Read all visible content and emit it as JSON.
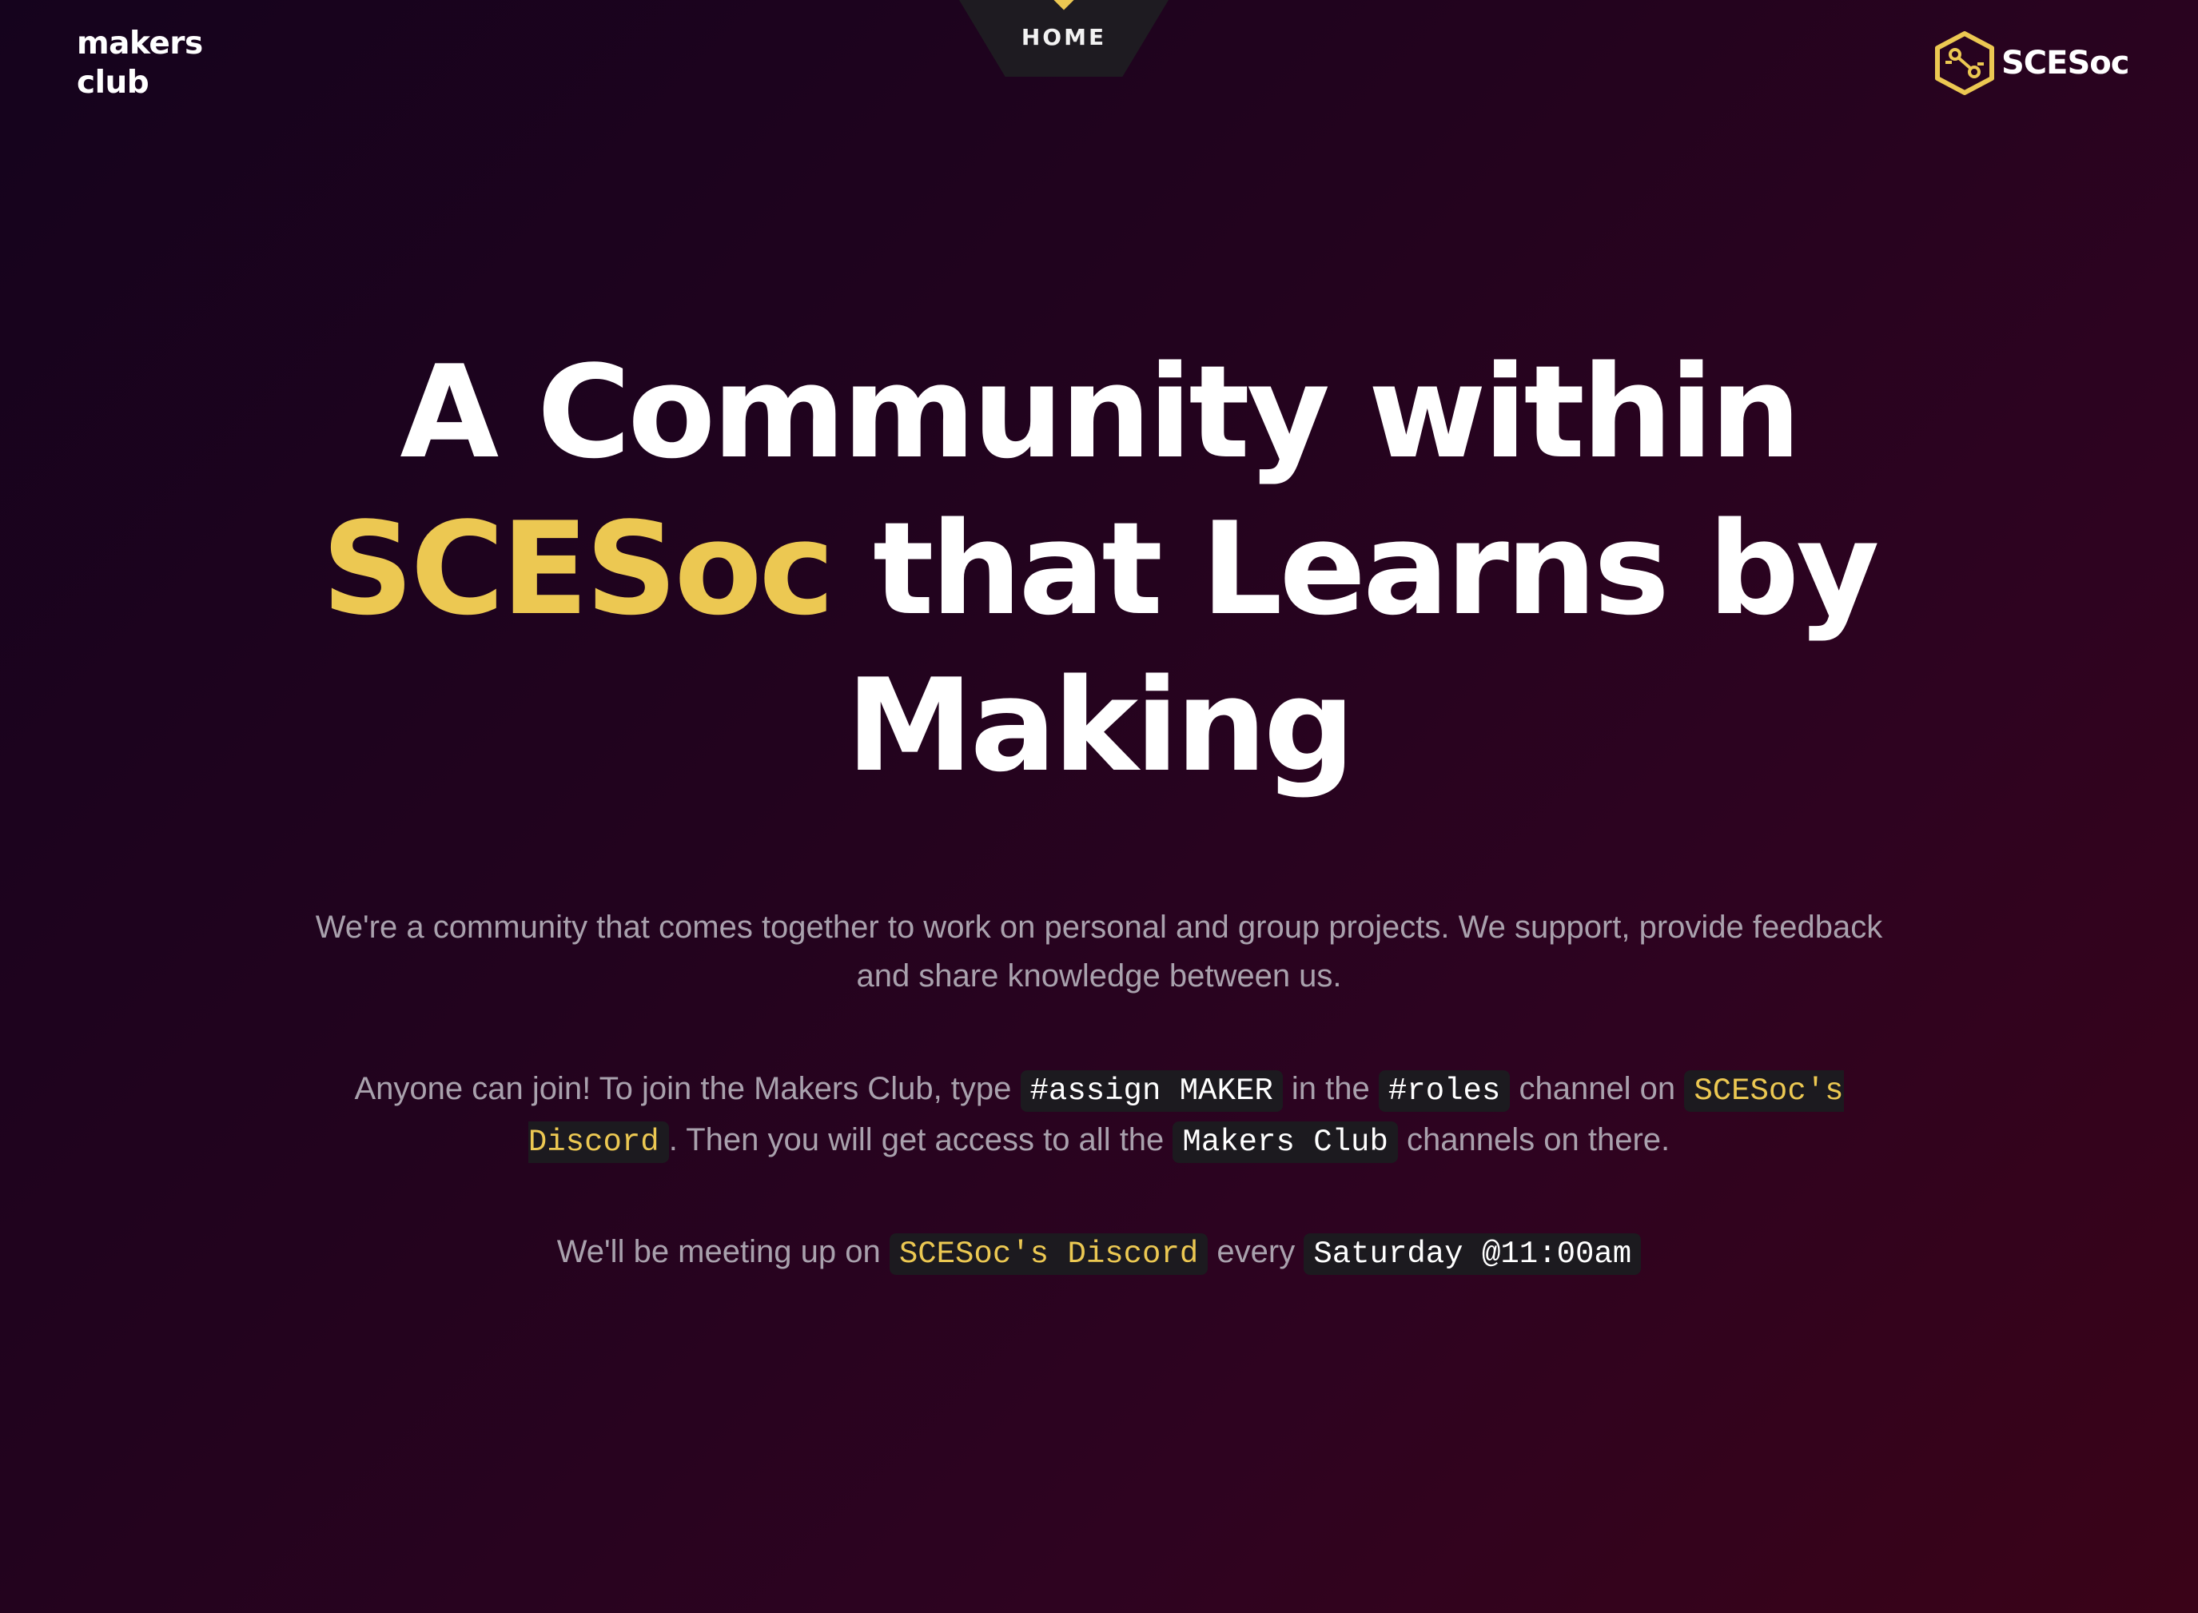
{
  "header": {
    "brand_line1": "makers",
    "brand_line2": "club",
    "nav_tab_label": "HOME",
    "org_logo_text": "SCESoc"
  },
  "hero": {
    "heading_part1": "A Community within",
    "heading_accent": "SCESoc",
    "heading_part2": "that Learns by Making"
  },
  "intro": {
    "text": "We're a community that comes together to work on personal and group projects. We support, provide feedback and share knowledge between us."
  },
  "join": {
    "text1": "Anyone can join! To join the Makers Club, type",
    "code_assign": "#assign MAKER",
    "text2": "in the",
    "code_roles": "#roles",
    "text3": "channel on",
    "code_discord": "SCESoc's Discord",
    "text4": ". Then you will get access to all the",
    "code_makers": "Makers Club",
    "text5": "channels on there."
  },
  "meetup": {
    "text1": "We'll be meeting up on",
    "code_discord": "SCESoc's Discord",
    "text2": "every",
    "code_time": "Saturday @11:00am"
  },
  "colors": {
    "accent": "#ecc852",
    "background_start": "#15031d",
    "background_end": "#3a0318",
    "body_text": "#a9a1ad",
    "code_background": "#1c1a1f"
  },
  "icons": {
    "org_logo": "hexagon-circuit-icon",
    "nav_marker": "diamond-marker-icon"
  }
}
